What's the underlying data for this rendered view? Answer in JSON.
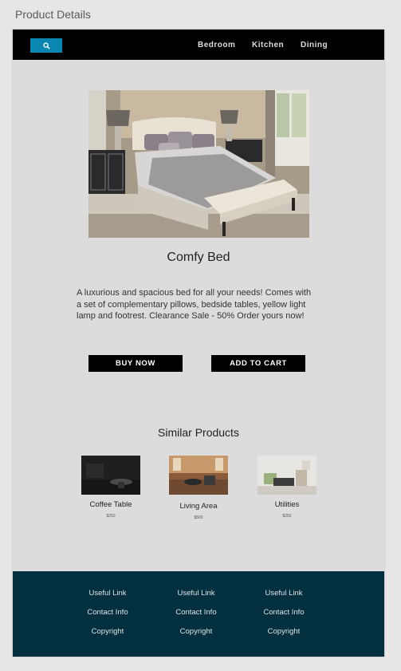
{
  "window": {
    "title": "Product Details"
  },
  "nav": {
    "search_icon": "search-icon",
    "links": [
      "Bedroom",
      "Kitchen",
      "Dining"
    ]
  },
  "product": {
    "title": "Comfy Bed",
    "description": "A luxurious and spacious bed for all your needs! Comes with a set of complementary pillows, bedside tables, yellow light lamp and footrest. Clearance Sale - 50% Order yours now!",
    "buy_label": "BUY NOW",
    "cart_label": "ADD TO CART"
  },
  "similar": {
    "title": "Similar Products",
    "items": [
      {
        "name": "Coffee Table",
        "price": "$250"
      },
      {
        "name": "Living Area",
        "price": "$500"
      },
      {
        "name": "Utilities",
        "price": "$250"
      }
    ]
  },
  "footer": {
    "columns": [
      [
        "Useful Link",
        "Contact Info",
        "Copyright"
      ],
      [
        "Useful Link",
        "Contact Info",
        "Copyright"
      ],
      [
        "Useful Link",
        "Contact Info",
        "Copyright"
      ]
    ]
  },
  "colors": {
    "accent": "#0a87b0",
    "navbar": "#000000",
    "footer": "#03303f",
    "background": "#dcdcdc"
  }
}
